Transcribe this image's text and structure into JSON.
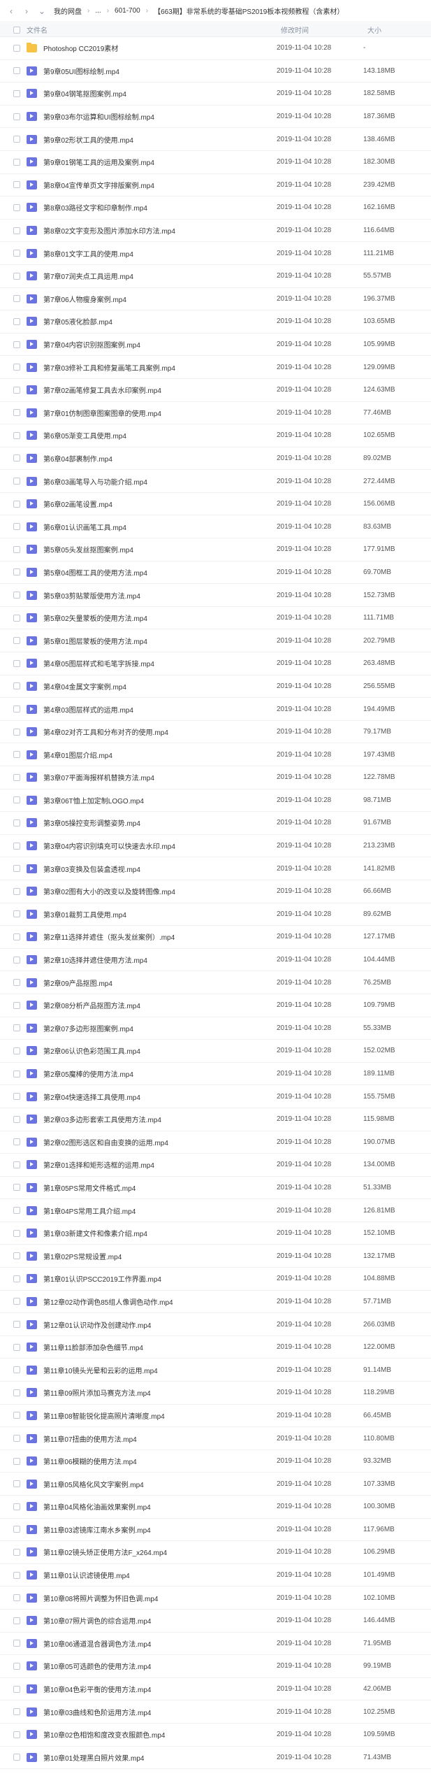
{
  "nav": {
    "breadcrumb": [
      "我的网盘",
      "...",
      "601-700",
      "【663期】非常系统的零基础PS2019板本视频教程（含素材）"
    ]
  },
  "table": {
    "headers": {
      "name": "文件名",
      "time": "修改时间",
      "size": "大小"
    },
    "rows": [
      {
        "type": "folder",
        "name": "Photoshop CC2019素材",
        "time": "2019-11-04 10:28",
        "size": "-"
      },
      {
        "type": "video",
        "name": "第9章05UI图标绘制.mp4",
        "time": "2019-11-04 10:28",
        "size": "143.18MB"
      },
      {
        "type": "video",
        "name": "第9章04钢笔抠图案例.mp4",
        "time": "2019-11-04 10:28",
        "size": "182.58MB"
      },
      {
        "type": "video",
        "name": "第9章03布尔运算和UI图标绘制.mp4",
        "time": "2019-11-04 10:28",
        "size": "187.36MB"
      },
      {
        "type": "video",
        "name": "第9章02形状工具的使用.mp4",
        "time": "2019-11-04 10:28",
        "size": "138.46MB"
      },
      {
        "type": "video",
        "name": "第9章01钢笔工具的运用及案例.mp4",
        "time": "2019-11-04 10:28",
        "size": "182.30MB"
      },
      {
        "type": "video",
        "name": "第8章04宣传单页文字排版案例.mp4",
        "time": "2019-11-04 10:28",
        "size": "239.42MB"
      },
      {
        "type": "video",
        "name": "第8章03路径文字和印章制作.mp4",
        "time": "2019-11-04 10:28",
        "size": "162.16MB"
      },
      {
        "type": "video",
        "name": "第8章02文字变形及图片添加水印方法.mp4",
        "time": "2019-11-04 10:28",
        "size": "116.64MB"
      },
      {
        "type": "video",
        "name": "第8章01文字工具的使用.mp4",
        "time": "2019-11-04 10:28",
        "size": "111.21MB"
      },
      {
        "type": "video",
        "name": "第7章07润夹点工具运用.mp4",
        "time": "2019-11-04 10:28",
        "size": "55.57MB"
      },
      {
        "type": "video",
        "name": "第7章06人物瘦身案例.mp4",
        "time": "2019-11-04 10:28",
        "size": "196.37MB"
      },
      {
        "type": "video",
        "name": "第7章05液化脸部.mp4",
        "time": "2019-11-04 10:28",
        "size": "103.65MB"
      },
      {
        "type": "video",
        "name": "第7章04内容识别抠图案例.mp4",
        "time": "2019-11-04 10:28",
        "size": "105.99MB"
      },
      {
        "type": "video",
        "name": "第7章03修补工具和修复画笔工具案例.mp4",
        "time": "2019-11-04 10:28",
        "size": "129.09MB"
      },
      {
        "type": "video",
        "name": "第7章02画笔修复工具去水印案例.mp4",
        "time": "2019-11-04 10:28",
        "size": "124.63MB"
      },
      {
        "type": "video",
        "name": "第7章01仿制图章图案图章的使用.mp4",
        "time": "2019-11-04 10:28",
        "size": "77.46MB"
      },
      {
        "type": "video",
        "name": "第6章05渐变工具使用.mp4",
        "time": "2019-11-04 10:28",
        "size": "102.65MB"
      },
      {
        "type": "video",
        "name": "第6章04部裹制作.mp4",
        "time": "2019-11-04 10:28",
        "size": "89.02MB"
      },
      {
        "type": "video",
        "name": "第6章03画笔导入与功能介绍.mp4",
        "time": "2019-11-04 10:28",
        "size": "272.44MB"
      },
      {
        "type": "video",
        "name": "第6章02画笔设置.mp4",
        "time": "2019-11-04 10:28",
        "size": "156.06MB"
      },
      {
        "type": "video",
        "name": "第6章01认识画笔工具.mp4",
        "time": "2019-11-04 10:28",
        "size": "83.63MB"
      },
      {
        "type": "video",
        "name": "第5章05头发丝抠图案例.mp4",
        "time": "2019-11-04 10:28",
        "size": "177.91MB"
      },
      {
        "type": "video",
        "name": "第5章04图框工具的使用方法.mp4",
        "time": "2019-11-04 10:28",
        "size": "69.70MB"
      },
      {
        "type": "video",
        "name": "第5章03剪贴蒙版使用方法.mp4",
        "time": "2019-11-04 10:28",
        "size": "152.73MB"
      },
      {
        "type": "video",
        "name": "第5章02矢量蒙板的使用方法.mp4",
        "time": "2019-11-04 10:28",
        "size": "111.71MB"
      },
      {
        "type": "video",
        "name": "第5章01图层蒙板的使用方法.mp4",
        "time": "2019-11-04 10:28",
        "size": "202.79MB"
      },
      {
        "type": "video",
        "name": "第4章05图层样式和毛笔字拆接.mp4",
        "time": "2019-11-04 10:28",
        "size": "263.48MB"
      },
      {
        "type": "video",
        "name": "第4章04金属文字案例.mp4",
        "time": "2019-11-04 10:28",
        "size": "256.55MB"
      },
      {
        "type": "video",
        "name": "第4章03图层样式的运用.mp4",
        "time": "2019-11-04 10:28",
        "size": "194.49MB"
      },
      {
        "type": "video",
        "name": "第4章02对齐工具和分布对齐的使用.mp4",
        "time": "2019-11-04 10:28",
        "size": "79.17MB"
      },
      {
        "type": "video",
        "name": "第4章01图层介绍.mp4",
        "time": "2019-11-04 10:28",
        "size": "197.43MB"
      },
      {
        "type": "video",
        "name": "第3章07平面海报样机替换方法.mp4",
        "time": "2019-11-04 10:28",
        "size": "122.78MB"
      },
      {
        "type": "video",
        "name": "第3章06T恤上加定制LOGO.mp4",
        "time": "2019-11-04 10:28",
        "size": "98.71MB"
      },
      {
        "type": "video",
        "name": "第3章05操控变形调整姿势.mp4",
        "time": "2019-11-04 10:28",
        "size": "91.67MB"
      },
      {
        "type": "video",
        "name": "第3章04内容识别填充可以快速去水印.mp4",
        "time": "2019-11-04 10:28",
        "size": "213.23MB"
      },
      {
        "type": "video",
        "name": "第3章03变换及包装盒透视.mp4",
        "time": "2019-11-04 10:28",
        "size": "141.82MB"
      },
      {
        "type": "video",
        "name": "第3章02图有大小的改变以及旋转图像.mp4",
        "time": "2019-11-04 10:28",
        "size": "66.66MB"
      },
      {
        "type": "video",
        "name": "第3章01裁剪工具使用.mp4",
        "time": "2019-11-04 10:28",
        "size": "89.62MB"
      },
      {
        "type": "video",
        "name": "第2章11选择并遮住（抠头发丝案例）.mp4",
        "time": "2019-11-04 10:28",
        "size": "127.17MB"
      },
      {
        "type": "video",
        "name": "第2章10选择并遮住使用方法.mp4",
        "time": "2019-11-04 10:28",
        "size": "104.44MB"
      },
      {
        "type": "video",
        "name": "第2章09产品抠图.mp4",
        "time": "2019-11-04 10:28",
        "size": "76.25MB"
      },
      {
        "type": "video",
        "name": "第2章08分析产品抠图方法.mp4",
        "time": "2019-11-04 10:28",
        "size": "109.79MB"
      },
      {
        "type": "video",
        "name": "第2章07多边形抠图案例.mp4",
        "time": "2019-11-04 10:28",
        "size": "55.33MB"
      },
      {
        "type": "video",
        "name": "第2章06认识色彩范围工具.mp4",
        "time": "2019-11-04 10:28",
        "size": "152.02MB"
      },
      {
        "type": "video",
        "name": "第2章05魔棒的使用方法.mp4",
        "time": "2019-11-04 10:28",
        "size": "189.11MB"
      },
      {
        "type": "video",
        "name": "第2章04快速选择工具使用.mp4",
        "time": "2019-11-04 10:28",
        "size": "155.75MB"
      },
      {
        "type": "video",
        "name": "第2章03多边形套索工具使用方法.mp4",
        "time": "2019-11-04 10:28",
        "size": "115.98MB"
      },
      {
        "type": "video",
        "name": "第2章02图形选区和自由变换的运用.mp4",
        "time": "2019-11-04 10:28",
        "size": "190.07MB"
      },
      {
        "type": "video",
        "name": "第2章01选择和矩形选框的运用.mp4",
        "time": "2019-11-04 10:28",
        "size": "134.00MB"
      },
      {
        "type": "video",
        "name": "第1章05PS常用文件格式.mp4",
        "time": "2019-11-04 10:28",
        "size": "51.33MB"
      },
      {
        "type": "video",
        "name": "第1章04PS常用工具介绍.mp4",
        "time": "2019-11-04 10:28",
        "size": "126.81MB"
      },
      {
        "type": "video",
        "name": "第1章03新建文件和像素介绍.mp4",
        "time": "2019-11-04 10:28",
        "size": "152.10MB"
      },
      {
        "type": "video",
        "name": "第1章02PS常规设置.mp4",
        "time": "2019-11-04 10:28",
        "size": "132.17MB"
      },
      {
        "type": "video",
        "name": "第1章01认识PSCC2019工作界面.mp4",
        "time": "2019-11-04 10:28",
        "size": "104.88MB"
      },
      {
        "type": "video",
        "name": "第12章02动作调色85组人像调色动作.mp4",
        "time": "2019-11-04 10:28",
        "size": "57.71MB"
      },
      {
        "type": "video",
        "name": "第12章01认识动作及创建动作.mp4",
        "time": "2019-11-04 10:28",
        "size": "266.03MB"
      },
      {
        "type": "video",
        "name": "第11章11脸部添加杂色细节.mp4",
        "time": "2019-11-04 10:28",
        "size": "122.00MB"
      },
      {
        "type": "video",
        "name": "第11章10镜头光晕和云彩的运用.mp4",
        "time": "2019-11-04 10:28",
        "size": "91.14MB"
      },
      {
        "type": "video",
        "name": "第11章09照片添加马赛克方法.mp4",
        "time": "2019-11-04 10:28",
        "size": "118.29MB"
      },
      {
        "type": "video",
        "name": "第11章08智能锐化提高照片清晰度.mp4",
        "time": "2019-11-04 10:28",
        "size": "66.45MB"
      },
      {
        "type": "video",
        "name": "第11章07扭曲的使用方法.mp4",
        "time": "2019-11-04 10:28",
        "size": "110.80MB"
      },
      {
        "type": "video",
        "name": "第11章06模糊的使用方法.mp4",
        "time": "2019-11-04 10:28",
        "size": "93.32MB"
      },
      {
        "type": "video",
        "name": "第11章05风格化风文字案例.mp4",
        "time": "2019-11-04 10:28",
        "size": "107.33MB"
      },
      {
        "type": "video",
        "name": "第11章04风格化油画效果案例.mp4",
        "time": "2019-11-04 10:28",
        "size": "100.30MB"
      },
      {
        "type": "video",
        "name": "第11章03滤镜库江南水乡案例.mp4",
        "time": "2019-11-04 10:28",
        "size": "117.96MB"
      },
      {
        "type": "video",
        "name": "第11章02镜头矫正使用方法F_x264.mp4",
        "time": "2019-11-04 10:28",
        "size": "106.29MB"
      },
      {
        "type": "video",
        "name": "第11章01认识滤镜使用.mp4",
        "time": "2019-11-04 10:28",
        "size": "101.49MB"
      },
      {
        "type": "video",
        "name": "第10章08将照片调整为怀旧色调.mp4",
        "time": "2019-11-04 10:28",
        "size": "102.10MB"
      },
      {
        "type": "video",
        "name": "第10章07照片调色的综合运用.mp4",
        "time": "2019-11-04 10:28",
        "size": "146.44MB"
      },
      {
        "type": "video",
        "name": "第10章06通道混合器调色方法.mp4",
        "time": "2019-11-04 10:28",
        "size": "71.95MB"
      },
      {
        "type": "video",
        "name": "第10章05可选颜色的使用方法.mp4",
        "time": "2019-11-04 10:28",
        "size": "99.19MB"
      },
      {
        "type": "video",
        "name": "第10章04色彩平衡的使用方法.mp4",
        "time": "2019-11-04 10:28",
        "size": "42.06MB"
      },
      {
        "type": "video",
        "name": "第10章03曲线和色阶运用方法.mp4",
        "time": "2019-11-04 10:28",
        "size": "102.25MB"
      },
      {
        "type": "video",
        "name": "第10章02色相饱和度改变衣服颜色.mp4",
        "time": "2019-11-04 10:28",
        "size": "109.59MB"
      },
      {
        "type": "video",
        "name": "第10章01处理黑白照片效果.mp4",
        "time": "2019-11-04 10:28",
        "size": "71.43MB"
      }
    ]
  }
}
